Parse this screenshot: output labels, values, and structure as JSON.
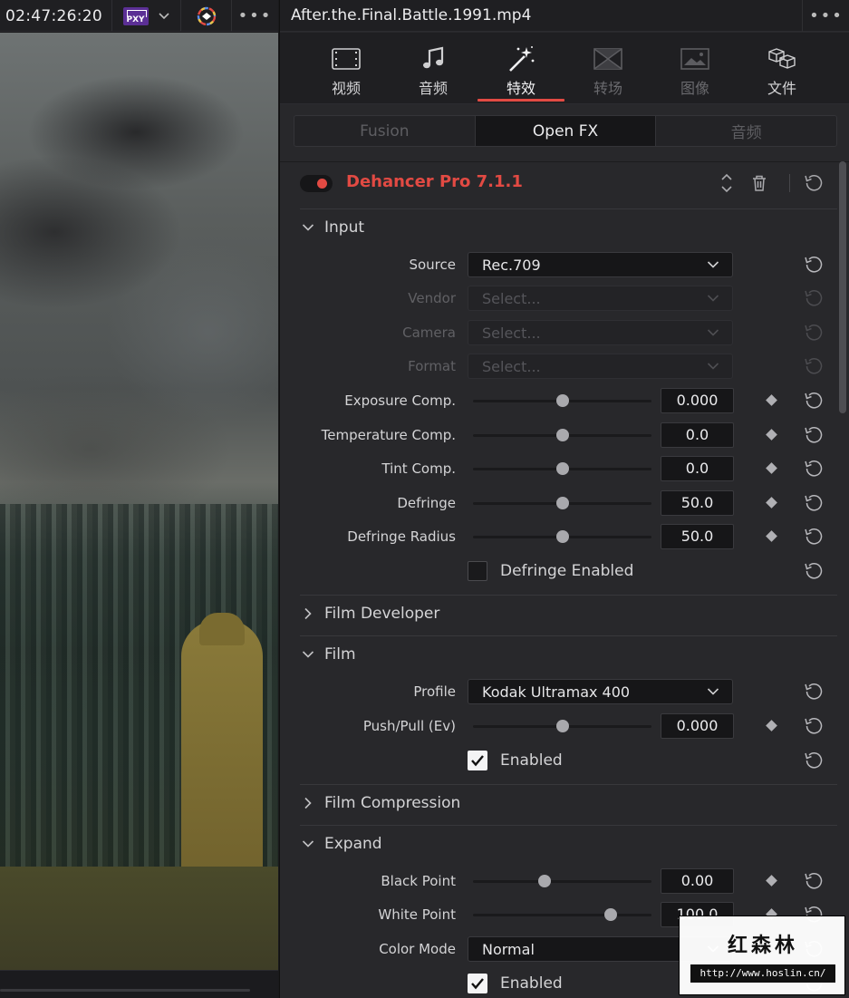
{
  "viewer": {
    "timecode": "02:47:26:20",
    "proxy_badge": "PXY",
    "more": "•••"
  },
  "inspector": {
    "clip_name": "After.the.Final.Battle.1991.mp4",
    "more": "•••",
    "tabs": [
      {
        "label": "视频",
        "icon": "filmstrip-icon",
        "state": "normal"
      },
      {
        "label": "音频",
        "icon": "music-note-icon",
        "state": "normal"
      },
      {
        "label": "特效",
        "icon": "magic-wand-icon",
        "state": "active"
      },
      {
        "label": "转场",
        "icon": "transition-icon",
        "state": "dim"
      },
      {
        "label": "图像",
        "icon": "image-icon",
        "state": "dim"
      },
      {
        "label": "文件",
        "icon": "file-cubes-icon",
        "state": "normal"
      }
    ],
    "subtabs": [
      "Fusion",
      "Open FX",
      "音频"
    ],
    "active_subtab": "Open FX",
    "plugin": {
      "title": "Dehancer Pro 7.1.1",
      "enabled": true,
      "accent_color": "#e24a43"
    },
    "sections": {
      "input": "Input",
      "film_developer": "Film Developer",
      "film": "Film",
      "film_compression": "Film Compression",
      "expand": "Expand"
    },
    "params": {
      "source": {
        "label": "Source",
        "value": "Rec.709"
      },
      "vendor": {
        "label": "Vendor",
        "value": "Select..."
      },
      "camera": {
        "label": "Camera",
        "value": "Select..."
      },
      "format": {
        "label": "Format",
        "value": "Select..."
      },
      "exposure_comp": {
        "label": "Exposure Comp.",
        "value": "0.000",
        "level": 0.5
      },
      "temperature_comp": {
        "label": "Temperature Comp.",
        "value": "0.0",
        "level": 0.5
      },
      "tint_comp": {
        "label": "Tint Comp.",
        "value": "0.0",
        "level": 0.5
      },
      "defringe": {
        "label": "Defringe",
        "value": "50.0",
        "level": 0.5
      },
      "defringe_radius": {
        "label": "Defringe Radius",
        "value": "50.0",
        "level": 0.5
      },
      "defringe_enabled": {
        "label": "Defringe Enabled",
        "checked": false
      },
      "profile": {
        "label": "Profile",
        "value": "Kodak Ultramax 400"
      },
      "push_pull": {
        "label": "Push/Pull (Ev)",
        "value": "0.000",
        "level": 0.5
      },
      "film_enabled": {
        "label": "Enabled",
        "checked": true
      },
      "black_point": {
        "label": "Black Point",
        "value": "0.00",
        "level": 0.4
      },
      "white_point": {
        "label": "White Point",
        "value": "100.0",
        "level": 0.77
      },
      "color_mode": {
        "label": "Color Mode",
        "value": "Normal"
      },
      "expand_enabled": {
        "label": "Enabled",
        "checked": true
      }
    }
  },
  "watermark": {
    "brand": "红森林",
    "url": "http://www.hoslin.cn/"
  }
}
